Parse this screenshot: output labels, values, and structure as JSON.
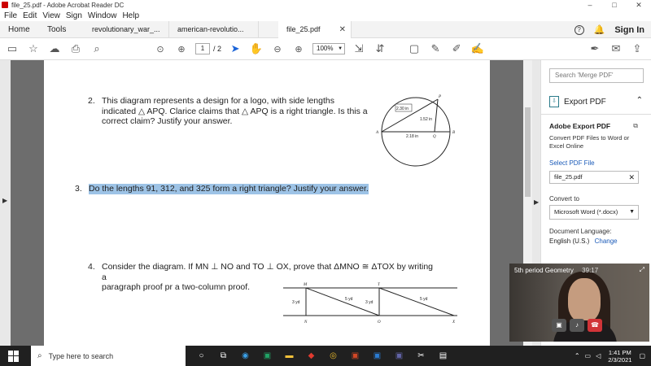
{
  "window": {
    "title": "file_25.pdf - Adobe Acrobat Reader DC",
    "controls": [
      "–",
      "□",
      "✕"
    ]
  },
  "menu": [
    "File",
    "Edit",
    "View",
    "Sign",
    "Window",
    "Help"
  ],
  "tabs": {
    "home": "Home",
    "tools": "Tools",
    "docs": [
      {
        "label": "revolutionary_war_..."
      },
      {
        "label": "american-revolutio..."
      },
      {
        "label": "file_25.pdf"
      }
    ],
    "close_symbol": "✕",
    "help_symbol": "?",
    "signin": "Sign In"
  },
  "toolbar": {
    "page_current": "1",
    "page_total": "/ 2",
    "zoom": "100%"
  },
  "document": {
    "q2": {
      "num": "2.",
      "line1": "This diagram represents a design for a logo, with side lengths",
      "line2": "indicated △ APQ. Clarice claims that △ APQ is a right triangle. Is this a",
      "line3": "correct claim? Justify your answer."
    },
    "q3": {
      "num": "3.",
      "text": "Do the lengths 91, 312, and 325 form a right triangle? Justify your answer."
    },
    "q4": {
      "num": "4.",
      "line1": "Consider the diagram. If MN ⊥ NO  and TO ⊥ OX, prove that ΔMNO ≅ ΔTOX by writing a",
      "line2": "paragraph proof pr a two-column proof."
    },
    "logo_diagram": {
      "labels": {
        "p": "P",
        "a": "A",
        "q": "Q",
        "b": "B"
      },
      "side_ap": "2.30 in",
      "side_pq": "1.52 in",
      "side_aq": "2.18 in"
    },
    "proof_diagram": {
      "labels": {
        "m": "M",
        "t": "T",
        "n": "N",
        "o": "O",
        "x": "X"
      },
      "side_mn": "3 yd",
      "side_mo": "5 yd",
      "side_to": "3 yd",
      "side_tx": "5 yd"
    }
  },
  "right_panel": {
    "search_placeholder": "Search 'Merge PDF'",
    "export_title": "Export PDF",
    "adobe_export_title": "Adobe Export PDF",
    "description": "Convert PDF Files to Word or Excel Online",
    "select_file": "Select PDF File",
    "file_name": "file_25.pdf",
    "convert_to_label": "Convert to",
    "convert_format": "Microsoft Word (*.docx)",
    "doc_lang_label": "Document Language:",
    "doc_lang": "English (U.S.)",
    "change": "Change"
  },
  "video": {
    "title": "5th period Geometry",
    "time": "39:17"
  },
  "taskbar": {
    "search_placeholder": "Type here to search",
    "time": "1:41 PM",
    "date": "2/3/2021"
  }
}
